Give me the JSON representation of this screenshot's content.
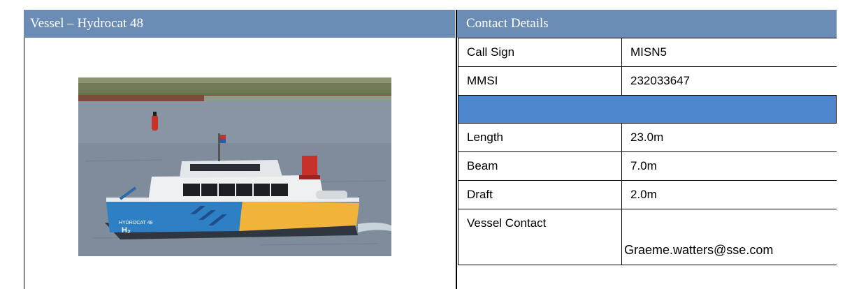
{
  "vessel_header": "Vessel – Hydrocat 48",
  "contact_header": "Contact Details",
  "photo": {
    "description_icon": "boat-photo",
    "hull_text": "HYDROCAT 48"
  },
  "details": [
    {
      "label": "Call Sign",
      "value": "MISN5"
    },
    {
      "label": "MMSI",
      "value": "232033647"
    },
    {
      "label": "",
      "value": ""
    },
    {
      "label": "Length",
      "value": "23.0m"
    },
    {
      "label": "Beam",
      "value": "7.0m"
    },
    {
      "label": "Draft",
      "value": "2.0m"
    },
    {
      "label": "Vessel Contact",
      "value": "Graeme.watters@sse.com"
    }
  ],
  "colors": {
    "header_bg": "#6b8cb5",
    "separator_row": "#4e86cd"
  }
}
